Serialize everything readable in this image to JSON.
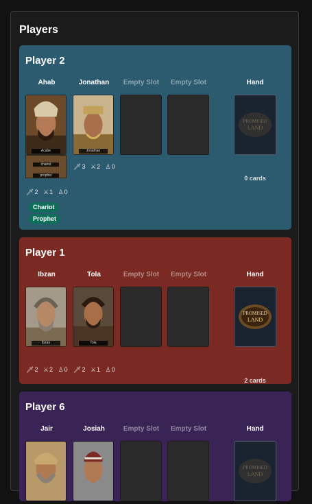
{
  "section_title": "Players",
  "players": [
    {
      "name": "Player 2",
      "color": "#2c5b6f",
      "slot1": {
        "label": "Ahab",
        "plate": "Acabe",
        "stats": [
          "2",
          "1",
          "0"
        ],
        "attachments": [
          "chariot",
          "prophet"
        ],
        "badges": [
          "Chariot",
          "Prophet"
        ]
      },
      "slot2": {
        "label": "Jonathan",
        "plate": "Jonathan",
        "stats": [
          "3",
          "2",
          "0"
        ]
      },
      "slot3": {
        "label": "Empty Slot"
      },
      "slot4": {
        "label": "Empty Slot"
      },
      "hand": {
        "label": "Hand",
        "count": "0 cards"
      }
    },
    {
      "name": "Player 1",
      "color": "#7a2a22",
      "slot1": {
        "label": "Ibzan",
        "plate": "Ibzan",
        "stats": [
          "2",
          "2",
          "0"
        ]
      },
      "slot2": {
        "label": "Tola",
        "plate": "Tola",
        "stats": [
          "2",
          "1",
          "0"
        ]
      },
      "slot3": {
        "label": "Empty Slot"
      },
      "slot4": {
        "label": "Empty Slot"
      },
      "hand": {
        "label": "Hand",
        "count": "2 cards"
      }
    },
    {
      "name": "Player 6",
      "color": "#3a2456",
      "slot1": {
        "label": "Jair"
      },
      "slot2": {
        "label": "Josiah"
      },
      "slot3": {
        "label": "Empty Slot"
      },
      "slot4": {
        "label": "Empty Slot"
      },
      "hand": {
        "label": "Hand"
      }
    }
  ],
  "icons": {
    "strength": "sword-icon",
    "defense": "crossed-swords-icon",
    "faith": "person-icon"
  },
  "logo_text": "PROMISED LAND"
}
